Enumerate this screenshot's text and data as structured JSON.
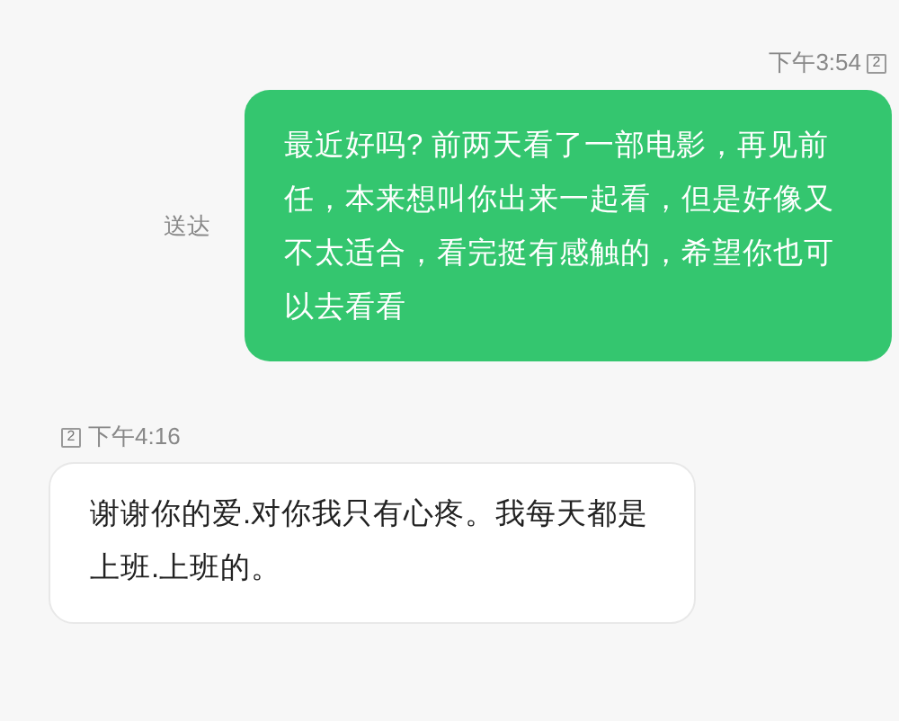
{
  "messages": [
    {
      "kind": "outgoing",
      "time": "下午3:54",
      "sim": "2",
      "status": "送达",
      "text": "最近好吗? 前两天看了一部电影，再见前任，本来想叫你出来一起看，但是好像又不太适合，看完挺有感触的，希望你也可以去看看"
    },
    {
      "kind": "incoming",
      "time": "下午4:16",
      "sim": "2",
      "text": "谢谢你的爱.对你我只有心疼。我每天都是上班.上班的。"
    }
  ]
}
